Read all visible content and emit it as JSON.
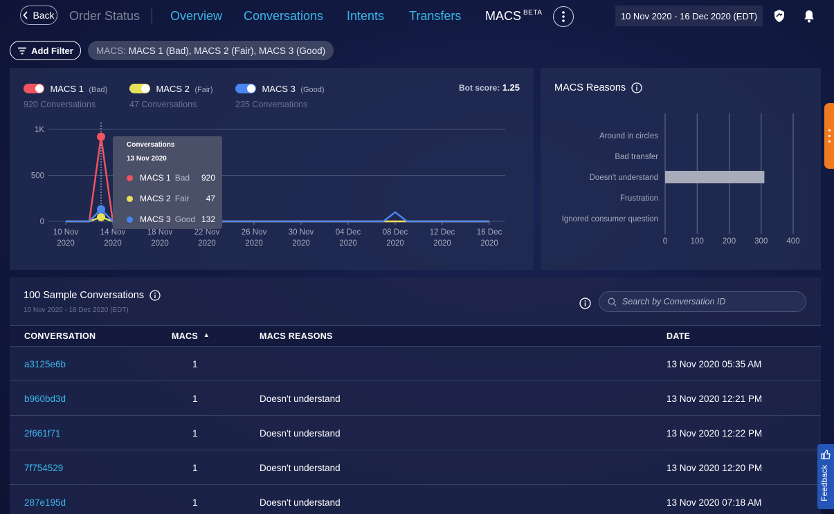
{
  "nav": {
    "back_label": "Back",
    "breadcrumb": "Order Status",
    "tabs": [
      "Overview",
      "Conversations",
      "Intents",
      "Transfers"
    ],
    "active_tab": "MACS",
    "beta": "BETA",
    "date_range": "10 Nov 2020 - 16 Dec 2020 (EDT)"
  },
  "filters": {
    "add_label": "Add Filter",
    "chip_key": "MACS:",
    "chip_value": "MACS 1 (Bad), MACS 2 (Fair), MACS 3 (Good)"
  },
  "legend": [
    {
      "name": "MACS 1",
      "quality": "(Bad)",
      "count": "920 Conversations",
      "color": "#f0545f"
    },
    {
      "name": "MACS 2",
      "quality": "(Fair)",
      "count": "47 Conversations",
      "color": "#e8e25a"
    },
    {
      "name": "MACS 3",
      "quality": "(Good)",
      "count": "235 Conversations",
      "color": "#4a86f0"
    }
  ],
  "bot_score": {
    "label": "Bot score:",
    "value": "1.25"
  },
  "tooltip": {
    "title": "Conversations",
    "date": "13 Nov 2020",
    "rows": [
      {
        "name": "MACS 1",
        "quality": "Bad",
        "value": "920"
      },
      {
        "name": "MACS 2",
        "quality": "Fair",
        "value": "47"
      },
      {
        "name": "MACS 3",
        "quality": "Good",
        "value": "132"
      }
    ]
  },
  "chart_data": [
    {
      "type": "line",
      "x": [
        "10 Nov 2020",
        "11 Nov 2020",
        "12 Nov 2020",
        "13 Nov 2020",
        "14 Nov 2020",
        "15 Nov 2020",
        "16 Nov 2020",
        "08 Dec 2020",
        "09 Dec 2020",
        "16 Dec 2020"
      ],
      "x_ticks": [
        {
          "line1": "10 Nov",
          "line2": "2020"
        },
        {
          "line1": "14 Nov",
          "line2": "2020"
        },
        {
          "line1": "18 Nov",
          "line2": "2020"
        },
        {
          "line1": "22 Nov",
          "line2": "2020"
        },
        {
          "line1": "26 Nov",
          "line2": "2020"
        },
        {
          "line1": "30 Nov",
          "line2": "2020"
        },
        {
          "line1": "04 Dec",
          "line2": "2020"
        },
        {
          "line1": "08 Dec",
          "line2": "2020"
        },
        {
          "line1": "12 Dec",
          "line2": "2020"
        },
        {
          "line1": "16 Dec",
          "line2": "2020"
        }
      ],
      "y_ticks": [
        "0",
        "500",
        "1K"
      ],
      "ylim": [
        0,
        1000
      ],
      "series": [
        {
          "name": "MACS 1",
          "color": "#f0545f",
          "points": [
            [
              "2020-11-10",
              0
            ],
            [
              "2020-11-12",
              0
            ],
            [
              "2020-11-13",
              920
            ],
            [
              "2020-11-14",
              0
            ],
            [
              "2020-12-16",
              0
            ]
          ]
        },
        {
          "name": "MACS 2",
          "color": "#e8e25a",
          "points": [
            [
              "2020-11-10",
              0
            ],
            [
              "2020-11-12",
              0
            ],
            [
              "2020-11-13",
              47
            ],
            [
              "2020-11-14",
              0
            ],
            [
              "2020-12-16",
              0
            ]
          ]
        },
        {
          "name": "MACS 3",
          "color": "#4a86f0",
          "points": [
            [
              "2020-11-10",
              0
            ],
            [
              "2020-11-12",
              0
            ],
            [
              "2020-11-13",
              132
            ],
            [
              "2020-11-14",
              0
            ],
            [
              "2020-12-07",
              0
            ],
            [
              "2020-12-08",
              100
            ],
            [
              "2020-12-09",
              0
            ],
            [
              "2020-12-16",
              0
            ]
          ]
        }
      ]
    },
    {
      "type": "bar",
      "title": "MACS Reasons",
      "orientation": "horizontal",
      "categories": [
        "Around in circles",
        "Bad transfer",
        "Doesn't understand",
        "Frustration",
        "Ignored consumer question"
      ],
      "values": [
        0,
        0,
        310,
        0,
        0
      ],
      "x_ticks": [
        "0",
        "100",
        "200",
        "300",
        "400"
      ],
      "xlim": [
        0,
        400
      ],
      "bar_color": "#a8abb9"
    }
  ],
  "table": {
    "title": "100 Sample Conversations",
    "subtitle": "10 Nov 2020 - 16 Dec 2020 (EDT)",
    "search_placeholder": "Search by Conversation ID",
    "columns": [
      "CONVERSATION",
      "MACS",
      "MACS REASONS",
      "DATE"
    ],
    "sort_indicator": "▲",
    "rows": [
      {
        "id": "a3125e6b",
        "macs": "1",
        "reasons": "",
        "date": "13 Nov 2020 05:35 AM"
      },
      {
        "id": "b960bd3d",
        "macs": "1",
        "reasons": "Doesn't understand",
        "date": "13 Nov 2020 12:21 PM"
      },
      {
        "id": "2f661f71",
        "macs": "1",
        "reasons": "Doesn't understand",
        "date": "13 Nov 2020 12:22 PM"
      },
      {
        "id": "7f754529",
        "macs": "1",
        "reasons": "Doesn't understand",
        "date": "13 Nov 2020 12:20 PM"
      },
      {
        "id": "287e195d",
        "macs": "1",
        "reasons": "Doesn't understand",
        "date": "13 Nov 2020 07:18 AM"
      }
    ]
  },
  "feedback_label": "Feedback"
}
